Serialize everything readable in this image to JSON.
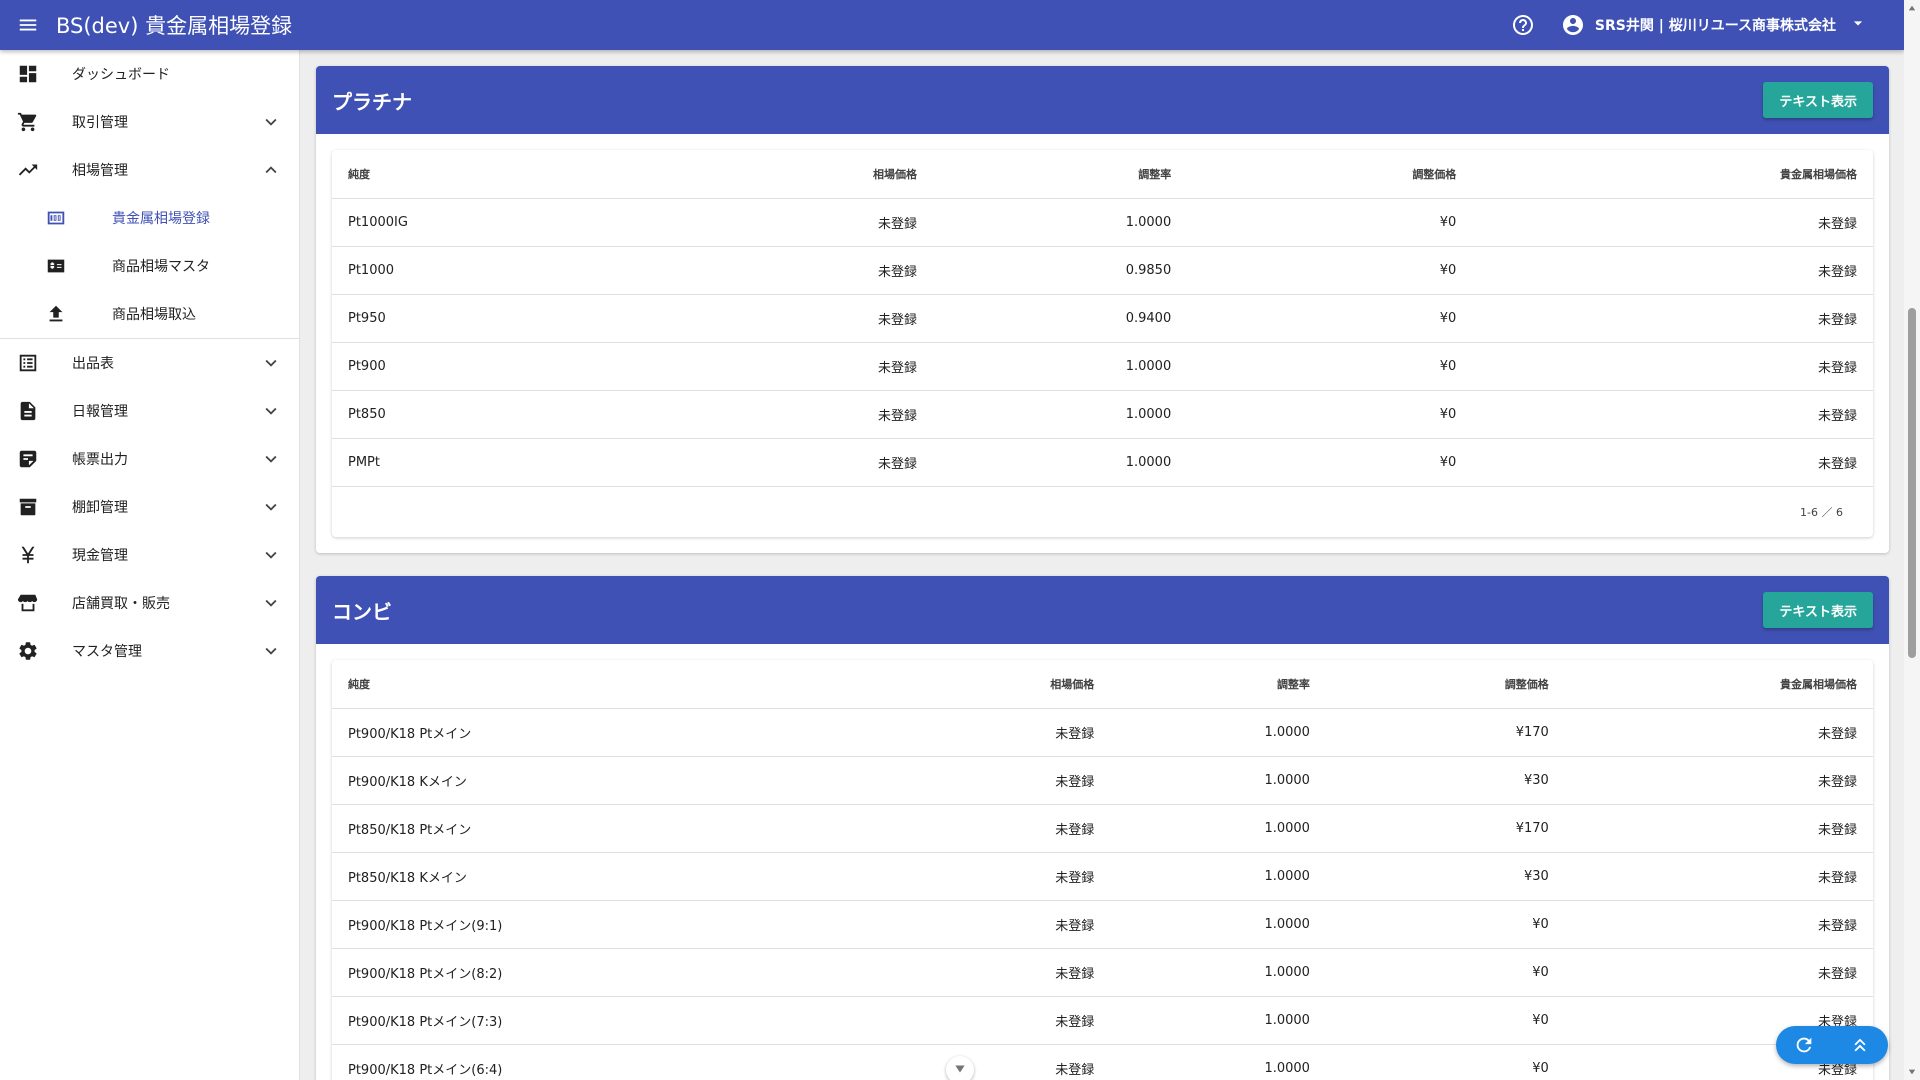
{
  "app": {
    "title": "BS(dev) 貴金属相場登録",
    "user": "SRS井関 | 桜川リユース商事株式会社"
  },
  "sidebar": {
    "items": [
      {
        "label": "ダッシュボード"
      },
      {
        "label": "取引管理"
      },
      {
        "label": "相場管理"
      },
      {
        "label": "出品表"
      },
      {
        "label": "日報管理"
      },
      {
        "label": "帳票出力"
      },
      {
        "label": "棚卸管理"
      },
      {
        "label": "現金管理"
      },
      {
        "label": "店舗買取・販売"
      },
      {
        "label": "マスタ管理"
      }
    ],
    "sub": [
      {
        "label": "貴金属相場登録"
      },
      {
        "label": "商品相場マスタ"
      },
      {
        "label": "商品相場取込"
      }
    ]
  },
  "platinum": {
    "title": "プラチナ",
    "button": "テキスト表示",
    "headers": [
      "純度",
      "相場価格",
      "調整率",
      "調整価格",
      "貴金属相場価格"
    ],
    "rows": [
      [
        "Pt1000IG",
        "未登録",
        "1.0000",
        "¥0",
        "未登録"
      ],
      [
        "Pt1000",
        "未登録",
        "0.9850",
        "¥0",
        "未登録"
      ],
      [
        "Pt950",
        "未登録",
        "0.9400",
        "¥0",
        "未登録"
      ],
      [
        "Pt900",
        "未登録",
        "1.0000",
        "¥0",
        "未登録"
      ],
      [
        "Pt850",
        "未登録",
        "1.0000",
        "¥0",
        "未登録"
      ],
      [
        "PMPt",
        "未登録",
        "1.0000",
        "¥0",
        "未登録"
      ]
    ],
    "pagination": "1-6 ／ 6"
  },
  "combi": {
    "title": "コンビ",
    "button": "テキスト表示",
    "headers": [
      "純度",
      "相場価格",
      "調整率",
      "調整価格",
      "貴金属相場価格"
    ],
    "rows": [
      [
        "Pt900/K18 Ptメイン",
        "未登録",
        "1.0000",
        "¥170",
        "未登録"
      ],
      [
        "Pt900/K18 Kメイン",
        "未登録",
        "1.0000",
        "¥30",
        "未登録"
      ],
      [
        "Pt850/K18 Ptメイン",
        "未登録",
        "1.0000",
        "¥170",
        "未登録"
      ],
      [
        "Pt850/K18 Kメイン",
        "未登録",
        "1.0000",
        "¥30",
        "未登録"
      ],
      [
        "Pt900/K18 Ptメイン(9:1)",
        "未登録",
        "1.0000",
        "¥0",
        "未登録"
      ],
      [
        "Pt900/K18 Ptメイン(8:2)",
        "未登録",
        "1.0000",
        "¥0",
        "未登録"
      ],
      [
        "Pt900/K18 Ptメイン(7:3)",
        "未登録",
        "1.0000",
        "¥0",
        "未登録"
      ],
      [
        "Pt900/K18 Ptメイン(6:4)",
        "未登録",
        "1.0000",
        "¥0",
        "未登録"
      ]
    ]
  }
}
